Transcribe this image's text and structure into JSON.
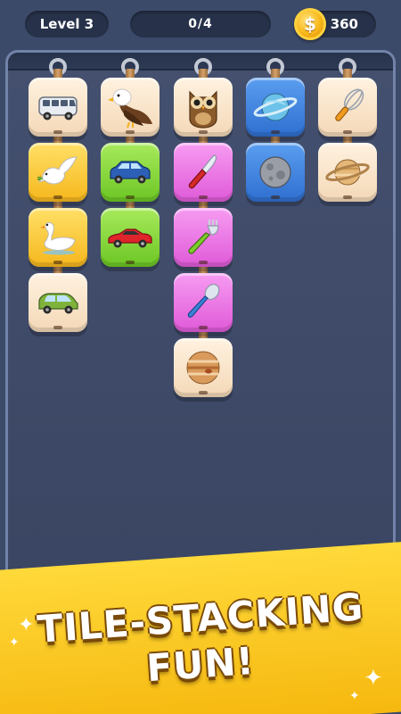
{
  "hud": {
    "level_label": "Level 3",
    "progress_text": "0/4",
    "coin_symbol": "$",
    "coin_count": "360"
  },
  "board": {
    "columns": [
      {
        "tiles": [
          {
            "icon": "van-icon",
            "color": "cream"
          },
          {
            "icon": "dove-icon",
            "color": "yellow"
          },
          {
            "icon": "swan-icon",
            "color": "yellow"
          },
          {
            "icon": "minivan-icon",
            "color": "cream"
          }
        ]
      },
      {
        "tiles": [
          {
            "icon": "eagle-icon",
            "color": "cream"
          },
          {
            "icon": "blue-car-icon",
            "color": "green"
          },
          {
            "icon": "red-sports-car-icon",
            "color": "green"
          }
        ]
      },
      {
        "tiles": [
          {
            "icon": "owl-icon",
            "color": "cream"
          },
          {
            "icon": "knife-icon",
            "color": "pink"
          },
          {
            "icon": "fork-icon",
            "color": "pink"
          },
          {
            "icon": "spoon-icon",
            "color": "pink"
          },
          {
            "icon": "jupiter-icon",
            "color": "cream"
          }
        ]
      },
      {
        "tiles": [
          {
            "icon": "ringed-planet-icon",
            "color": "blue"
          },
          {
            "icon": "moon-icon",
            "color": "blue"
          }
        ]
      },
      {
        "tiles": [
          {
            "icon": "whisk-icon",
            "color": "cream"
          },
          {
            "icon": "saturn-icon",
            "color": "cream"
          }
        ]
      }
    ]
  },
  "banner": {
    "line1": "TILE-STACKING",
    "line2": "FUN!"
  },
  "colors": {
    "background": "#3c4a6a",
    "banner": "#ffd23a",
    "tile_cream": "#f8e3c8",
    "tile_yellow": "#f9c82b",
    "tile_green": "#86d636",
    "tile_pink": "#e873e2",
    "tile_blue": "#3f86e0"
  }
}
